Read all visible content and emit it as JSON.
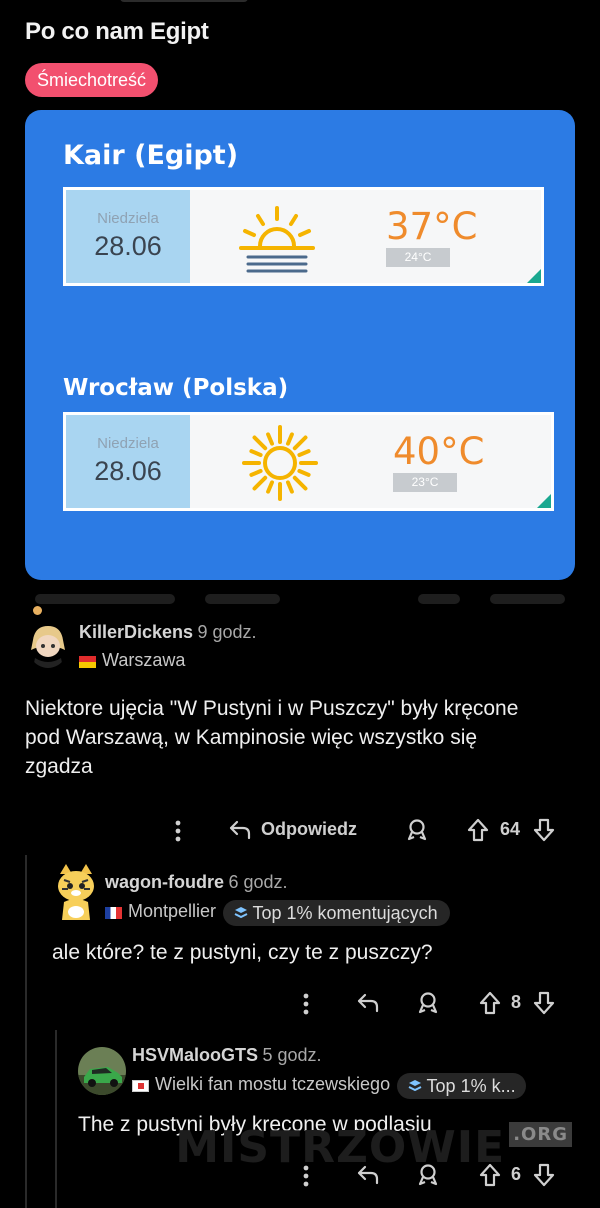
{
  "post": {
    "title": "Po co nam Egipt",
    "flair": "Śmiechotreść"
  },
  "image": {
    "panels": [
      {
        "city": "Kair (Egipt)",
        "day": "Niedziela",
        "date": "28.06",
        "temp_high": "37°C",
        "temp_low": "24°C",
        "weather": "sunrise-icon"
      },
      {
        "city": "Wrocław (Polska)",
        "day": "Niedziela",
        "date": "28.06",
        "temp_high": "40°C",
        "temp_low": "23°C",
        "weather": "sun-icon"
      }
    ],
    "colors": {
      "background": "#2c7be4",
      "date_panel": "#a9d5f1",
      "temp": "#ef8b2c",
      "sun": "#f5b400"
    }
  },
  "comments": [
    {
      "user": "KillerDickens",
      "time": "9 godz.",
      "location": "Warszawa",
      "body": "Niektore ujęcia \"W Pustyni i w Puszczy\" były kręcone pod Warszawą, w Kampinosie więc wszystko się zgadza",
      "reply_label": "Odpowiedz",
      "score": "64"
    },
    {
      "user": "wagon-foudre",
      "time": "6 godz.",
      "location": "Montpellier",
      "badge": "Top 1% komentujących",
      "body": "ale które? te z pustyni, czy te z puszczy?",
      "score": "8"
    },
    {
      "user": "HSVMalooGTS",
      "time": "5 godz.",
      "location": "Wielki fan mostu tczewskiego",
      "badge": "Top 1% k...",
      "body": "The z pustyni były kręcone w podlasiu",
      "score": "6"
    }
  ],
  "watermark": {
    "main": "MISTRZOWIE",
    "suffix": ".ORG"
  }
}
